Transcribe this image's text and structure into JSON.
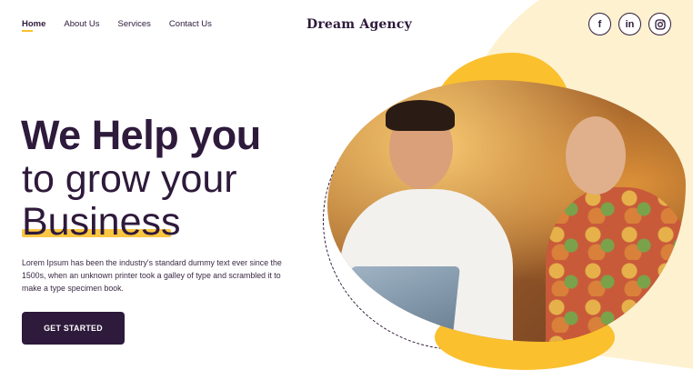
{
  "nav": {
    "items": [
      {
        "label": "Home",
        "active": true
      },
      {
        "label": "About Us",
        "active": false
      },
      {
        "label": "Services",
        "active": false
      },
      {
        "label": "Contact Us",
        "active": false
      }
    ]
  },
  "brand": {
    "name": "Dream Agency"
  },
  "socials": [
    {
      "icon": "facebook-icon",
      "glyph": "f"
    },
    {
      "icon": "linkedin-icon",
      "glyph": "in"
    },
    {
      "icon": "instagram-icon",
      "glyph": "◎"
    }
  ],
  "hero": {
    "headline_line1": "We Help you",
    "headline_line2": "to grow your",
    "headline_line3": "Business",
    "description": "Lorem Ipsum has been the industry's standard dummy text ever since the 1500s, when an unknown printer took a galley of type and scrambled it to make a type specimen book.",
    "cta_label": "GET STARTED"
  },
  "colors": {
    "primary": "#2e1a3b",
    "accent": "#fbc02d",
    "cream": "#fdf1cf"
  }
}
